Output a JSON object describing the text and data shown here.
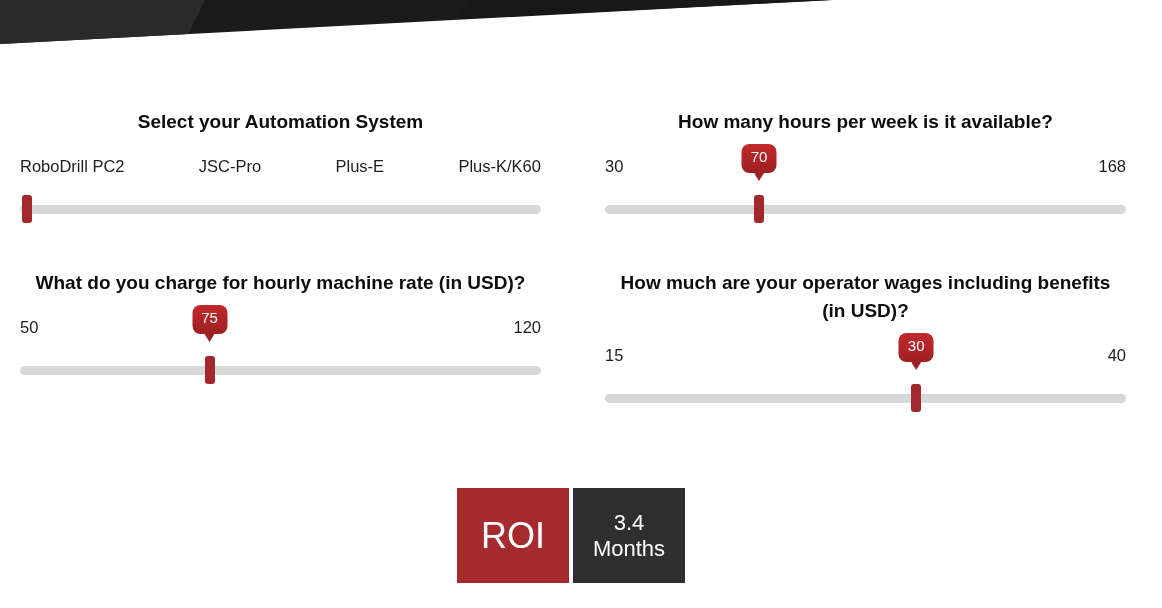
{
  "sliders": [
    {
      "kind": "steps",
      "title": "Select your Automation System",
      "options": [
        "RoboDrill PC2",
        "JSC-Pro",
        "Plus-E",
        "Plus-K/K60"
      ],
      "level": 0
    },
    {
      "kind": "range",
      "title": "How many hours per week is it available?",
      "min": "30",
      "max": "168",
      "value": "70",
      "level": 0.29
    },
    {
      "kind": "range",
      "title": "What do you charge for hourly machine rate (in USD)?",
      "min": "50",
      "max": "120",
      "value": "75",
      "level": 0.36
    },
    {
      "kind": "range",
      "title": "How much are your operator wages including benefits (in USD)?",
      "min": "15",
      "max": "40",
      "value": "30",
      "level": 0.6
    }
  ],
  "result": {
    "label": "ROI",
    "value": "3.4",
    "unit": "Months"
  }
}
